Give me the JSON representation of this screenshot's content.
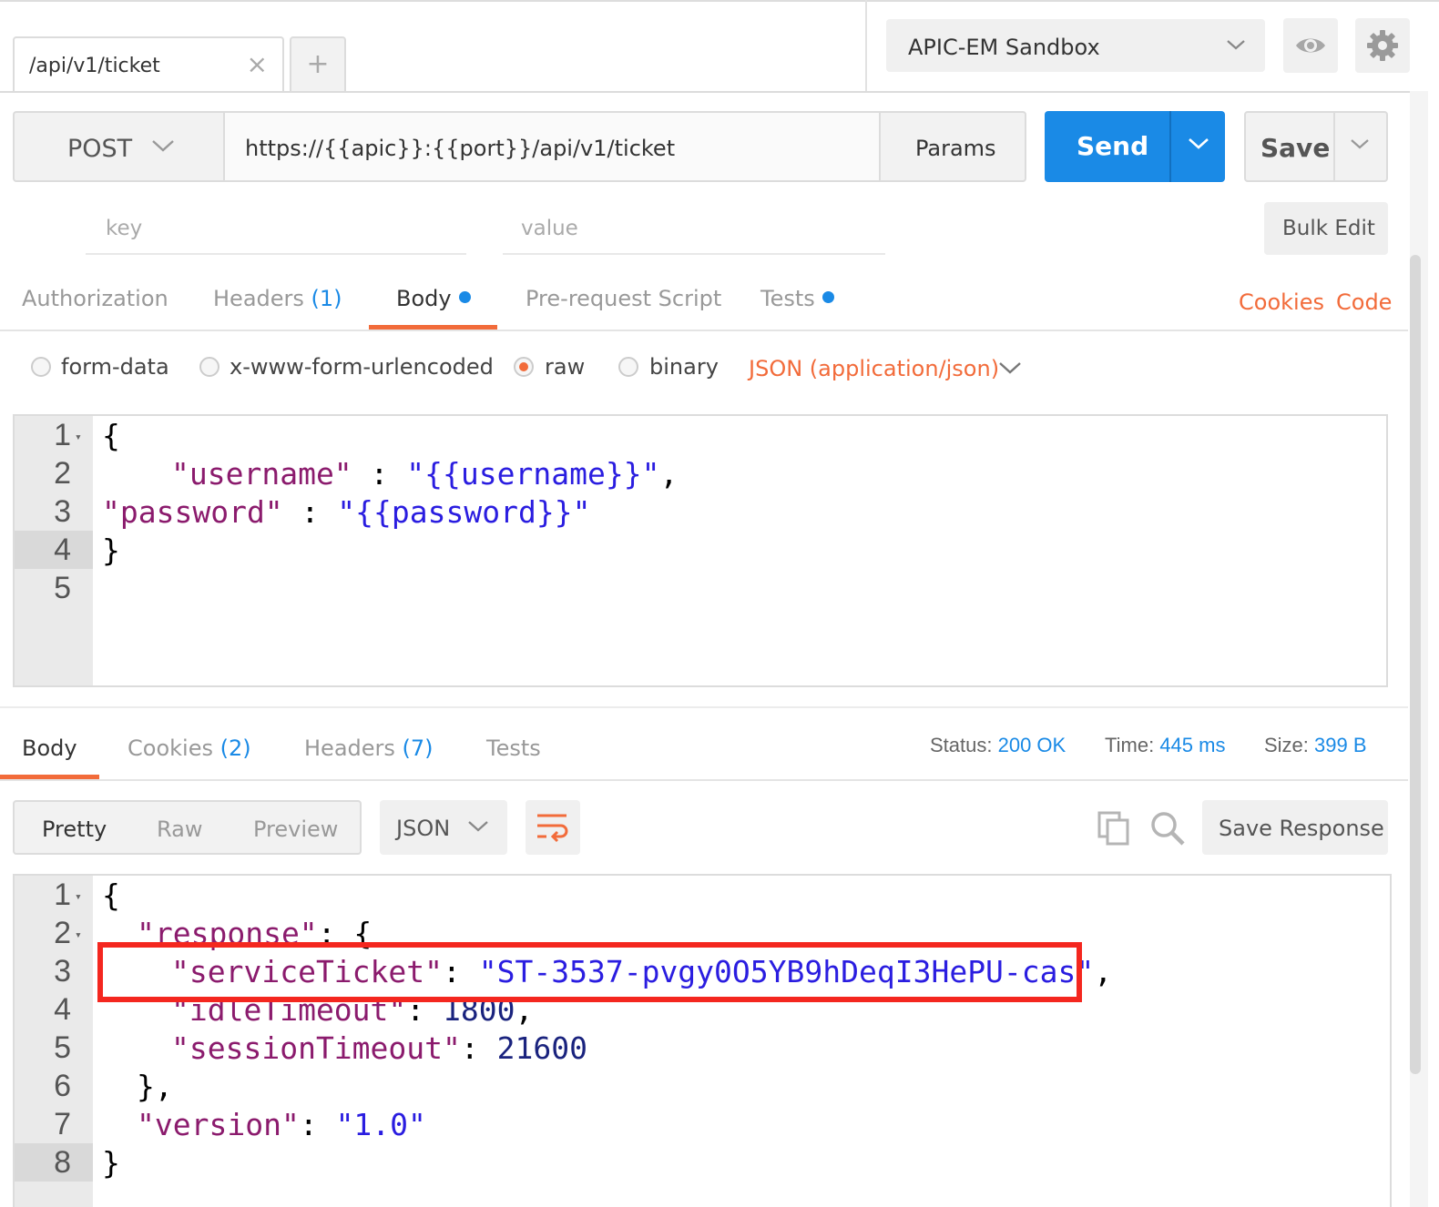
{
  "window": {
    "tab": {
      "title": "/api/v1/ticket",
      "close": "×"
    },
    "new_tab": "+",
    "environment": "APIC-EM Sandbox"
  },
  "request": {
    "method": "POST",
    "url": "https://{{apic}}:{{port}}/api/v1/ticket",
    "params_label": "Params",
    "send_label": "Send",
    "save_label": "Save",
    "key_placeholder": "key",
    "value_placeholder": "value",
    "bulk_edit_label": "Bulk Edit",
    "tabs": [
      {
        "label": "Authorization"
      },
      {
        "label": "Headers",
        "count": "(1)"
      },
      {
        "label": "Body",
        "dot": true
      },
      {
        "label": "Pre-request Script"
      },
      {
        "label": "Tests",
        "dot": true
      }
    ],
    "links": {
      "cookies": "Cookies",
      "code": "Code"
    },
    "body_types": [
      "form-data",
      "x-www-form-urlencoded",
      "raw",
      "binary"
    ],
    "selected_body_type": "raw",
    "content_type": "JSON (application/json)",
    "body_lines": [
      {
        "n": "1",
        "fold": true
      },
      {
        "n": "2"
      },
      {
        "n": "3"
      },
      {
        "n": "4",
        "active": true
      },
      {
        "n": "5"
      }
    ],
    "body_tokens": {
      "open": "{",
      "k1": "\"username\"",
      "sep1": " : ",
      "v1": "\"{{username}}\"",
      "comma": ",",
      "k2": "\"password\"",
      "sep2": " : ",
      "v2": "\"{{password}}\"",
      "close": "}"
    }
  },
  "response": {
    "tabs": [
      {
        "label": "Body"
      },
      {
        "label": "Cookies",
        "count": "(2)"
      },
      {
        "label": "Headers",
        "count": "(7)"
      },
      {
        "label": "Tests"
      }
    ],
    "status_label": "Status:",
    "status_value": "200 OK",
    "time_label": "Time:",
    "time_value": "445 ms",
    "size_label": "Size:",
    "size_value": "399 B",
    "view_modes": [
      "Pretty",
      "Raw",
      "Preview"
    ],
    "selected_view": "Pretty",
    "format": "JSON",
    "save_response_label": "Save Response",
    "tokens": {
      "l1": "{",
      "l2k": "\"response\"",
      "l2p": ": {",
      "l3k": "\"serviceTicket\"",
      "l3c": ": ",
      "l3v": "\"ST-3537-pvgy0O5YB9hDeqI3HePU-cas\"",
      "l3e": ",",
      "l4k": "\"idleTimeout\"",
      "l4c": ": ",
      "l4v": "1800",
      "l4e": ",",
      "l5k": "\"sessionTimeout\"",
      "l5c": ": ",
      "l5v": "21600",
      "l6": "},",
      "l7k": "\"version\"",
      "l7c": ": ",
      "l7v": "\"1.0\"",
      "l8": "}"
    },
    "line_numbers": [
      "1",
      "2",
      "3",
      "4",
      "5",
      "6",
      "7",
      "8"
    ]
  },
  "colors": {
    "accent_blue": "#1a8ae6",
    "accent_orange": "#f26b3a",
    "highlight_red": "#f4271f"
  }
}
